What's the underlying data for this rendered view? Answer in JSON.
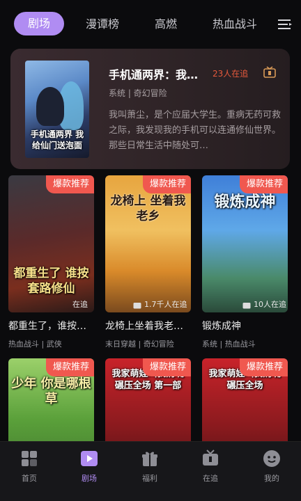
{
  "tabs": [
    {
      "label": "剧场",
      "active": true
    },
    {
      "label": "漫谭榜",
      "active": false
    },
    {
      "label": "高燃",
      "active": false
    },
    {
      "label": "热血战斗",
      "active": false
    }
  ],
  "featured": {
    "cover_text": "手机通两界 我给仙门送泡面",
    "title": "手机通两界：我…",
    "viewers": "23人在追",
    "tags": "系统 | 奇幻冒险",
    "description": "我叫萧尘，是个应届大学生。重病无药可救之际，我发现我的手机可以连通修仙世界。那些日常生活中随处可…"
  },
  "cards": [
    {
      "badge": "爆款推荐",
      "cover_text": "都重生了 谁按套路修仙",
      "viewers": "在追",
      "title": "都重生了，谁按…",
      "tags": "热血战斗 | 武侠"
    },
    {
      "badge": "爆款推荐",
      "cover_text": "龙椅上 坐着我老乡",
      "viewers": "1.7千人在追",
      "title": "龙椅上坐着我老…",
      "tags": "末日穿越 | 奇幻冒险"
    },
    {
      "badge": "爆款推荐",
      "cover_text": "锻炼成神",
      "viewers": "10人在追",
      "title": "锻炼成神",
      "tags": "系统 | 热血战斗"
    },
    {
      "badge": "爆款推荐",
      "cover_text": "少年 你是哪根草",
      "viewers": "",
      "title": "",
      "tags": ""
    },
    {
      "badge": "爆款推荐",
      "cover_text": "我家萌娃叫我奶嘴 碾压全场 第一部",
      "viewers": "",
      "title": "",
      "tags": ""
    },
    {
      "badge": "爆款推荐",
      "cover_text": "我家萌娃叫我奶嘴 碾压全场",
      "viewers": "",
      "title": "",
      "tags": ""
    }
  ],
  "nav": [
    {
      "label": "首页",
      "icon": "home-grid-icon",
      "active": false
    },
    {
      "label": "剧场",
      "icon": "play-icon",
      "active": true
    },
    {
      "label": "福利",
      "icon": "gift-icon",
      "active": false
    },
    {
      "label": "在追",
      "icon": "tv-icon",
      "active": false
    },
    {
      "label": "我的",
      "icon": "face-icon",
      "active": false
    }
  ],
  "colors": {
    "accent": "#b08cf2",
    "badge": "#f0584f",
    "viewer_count": "#e6593c",
    "background": "#0b0b0d"
  }
}
